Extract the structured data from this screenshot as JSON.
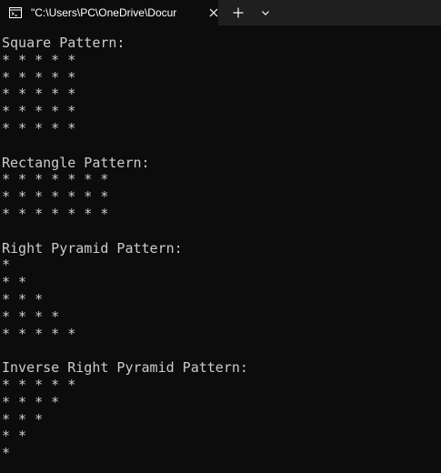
{
  "tab": {
    "title": "\"C:\\Users\\PC\\OneDrive\\Docur",
    "icon": "terminal-icon"
  },
  "titlebar": {
    "close_icon": "close-icon",
    "new_tab_icon": "plus-icon",
    "dropdown_icon": "chevron-down-icon"
  },
  "colors": {
    "background": "#0c0c0c",
    "titlebar": "#1f1f1f",
    "text": "#cccccc"
  },
  "console": {
    "lines": [
      "Square Pattern:",
      "* * * * *",
      "* * * * *",
      "* * * * *",
      "* * * * *",
      "* * * * *",
      "",
      "Rectangle Pattern:",
      "* * * * * * *",
      "* * * * * * *",
      "* * * * * * *",
      "",
      "Right Pyramid Pattern:",
      "*",
      "* *",
      "* * *",
      "* * * *",
      "* * * * *",
      "",
      "Inverse Right Pyramid Pattern:",
      "* * * * *",
      "* * * *",
      "* * *",
      "* *",
      "*"
    ]
  }
}
